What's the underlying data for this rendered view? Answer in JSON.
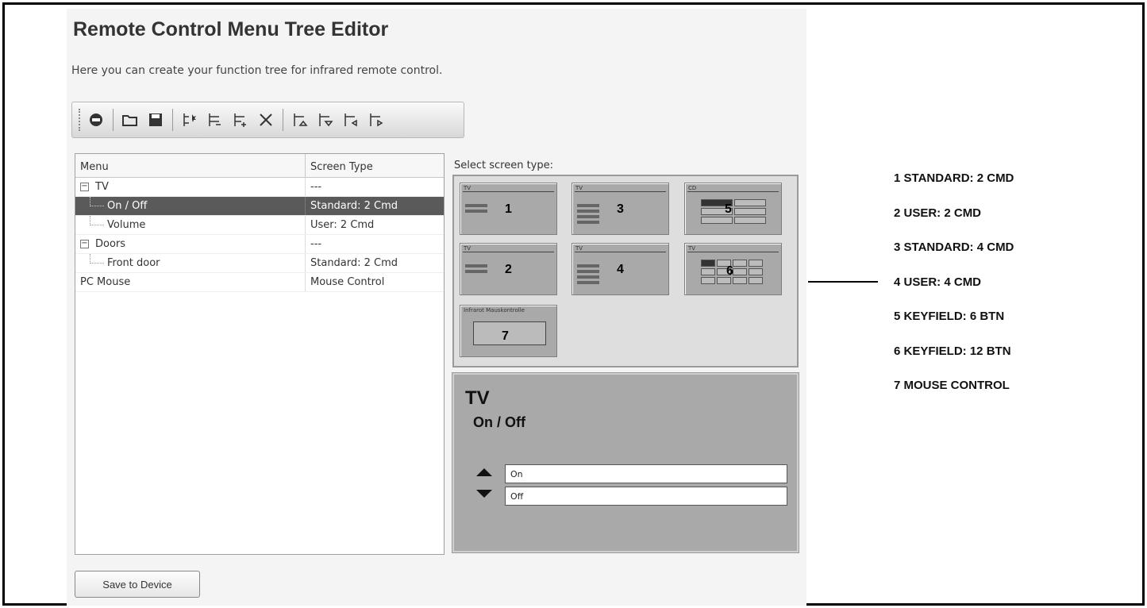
{
  "app": {
    "title": "Remote Control Menu Tree Editor",
    "subtitle": "Here you can create your function tree for infrared remote control."
  },
  "toolbar": {
    "icons": [
      "connect-icon",
      "open-folder-icon",
      "save-icon",
      "add-menu-icon",
      "add-submenu-icon",
      "indent-icon",
      "delete-icon",
      "move-up-icon",
      "move-down-icon",
      "move-left-icon",
      "move-right-icon"
    ]
  },
  "tree": {
    "headers": {
      "menu": "Menu",
      "screen_type": "Screen Type"
    },
    "rows": [
      {
        "expander": "−",
        "label": "TV",
        "type": "---"
      },
      {
        "label": "On / Off",
        "type": "Standard: 2 Cmd"
      },
      {
        "label": "Volume",
        "type": "User: 2 Cmd"
      },
      {
        "expander": "−",
        "label": "Doors",
        "type": "---"
      },
      {
        "label": "Front door",
        "type": "Standard: 2 Cmd"
      },
      {
        "label": "PC Mouse",
        "type": "Mouse Control"
      }
    ],
    "selected_index": 1
  },
  "screen_select": {
    "label": "Select screen type:",
    "thumbs": [
      {
        "num": "1",
        "title": "TV"
      },
      {
        "num": "3",
        "title": "TV"
      },
      {
        "num": "5",
        "title": "CD"
      },
      {
        "num": "2",
        "title": "TV"
      },
      {
        "num": "4",
        "title": "TV"
      },
      {
        "num": "6",
        "title": "TV"
      },
      {
        "num": "7",
        "title": "Infrarot Mauskontrolle"
      }
    ]
  },
  "preview": {
    "title": "TV",
    "subtitle": "On / Off",
    "input_1": "On",
    "input_2": "Off"
  },
  "save_button": "Save to Device",
  "legend": [
    "1 STANDARD: 2 CMD",
    "2 USER: 2 CMD",
    "3 STANDARD: 4 CMD",
    "4 USER: 4 CMD",
    "5 KEYFIELD: 6 BTN",
    "6 KEYFIELD: 12 BTN",
    "7 MOUSE CONTROL"
  ]
}
